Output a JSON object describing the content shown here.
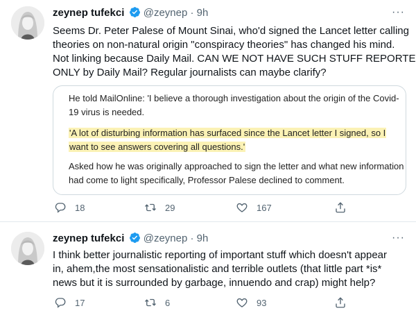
{
  "tweets": [
    {
      "name": "zeynep tufekci",
      "handle": "@zeynep",
      "dot": "·",
      "time": "9h",
      "more": "···",
      "lines": [
        "Seems Dr. Peter Palese of Mount Sinai, who'd signed the Lancet letter calling",
        "theories on non-natural origin \"conspiracy theories\" has changed his mind.",
        "Not linking because Daily Mail. CAN WE NOT HAVE SUCH STUFF REPORTED",
        "ONLY by Daily Mail? Regular journalists can maybe clarify?"
      ],
      "card": {
        "p1": [
          "He told MailOnline: 'I believe a thorough investigation about the origin of the Covid-",
          "19 virus is needed."
        ],
        "quote": [
          "'A lot of disturbing information has surfaced since the Lancet letter I signed, so I",
          "want to see answers covering all questions.'"
        ],
        "p3": [
          "Asked how he was originally approached to sign the letter and what new information",
          "had come to light specifically, Professor Palese declined to comment."
        ]
      },
      "actions": {
        "replies": "18",
        "retweets": "29",
        "likes": "167"
      }
    },
    {
      "name": "zeynep tufekci",
      "handle": "@zeynep",
      "dot": "·",
      "time": "9h",
      "more": "···",
      "lines": [
        "I  think better journalistic reporting of important stuff which doesn't appear",
        "in, ahem,the most sensationalistic and terrible outlets (that little part *is*",
        "news but it is surrounded by garbage, innuendo and crap) might help?"
      ],
      "actions": {
        "replies": "17",
        "retweets": "6",
        "likes": "93"
      }
    }
  ],
  "colors": {
    "verified": "#1d9bf0",
    "secondary": "#536471",
    "highlight": "#fbf2b5"
  }
}
